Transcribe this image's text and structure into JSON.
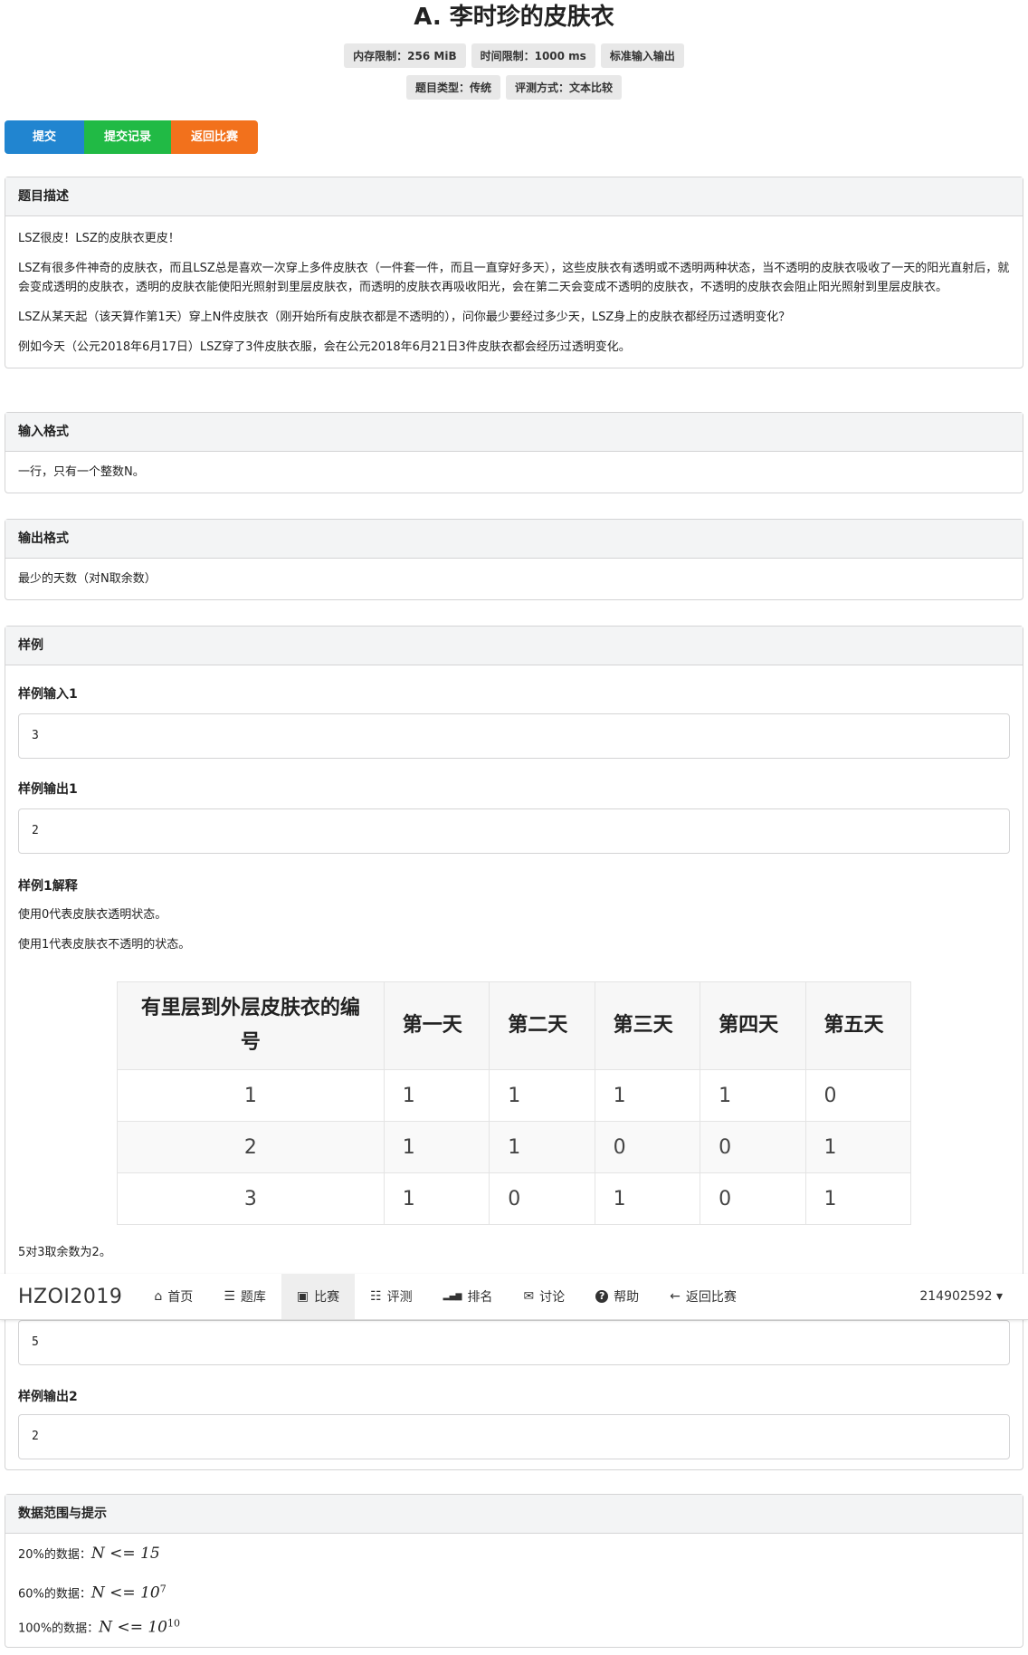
{
  "problem": {
    "title": "A. 李时珍的皮肤衣",
    "labels_row1": [
      "内存限制：256 MiB",
      "时间限制：1000 ms",
      "标准输入输出"
    ],
    "labels_row2": [
      "题目类型：传统",
      "评测方式：文本比较"
    ]
  },
  "actions": {
    "submit": "提交",
    "records": "提交记录",
    "back": "返回比赛"
  },
  "colors": {
    "blue": "#2185d0",
    "green": "#21ba45",
    "orange": "#f2711c"
  },
  "description": {
    "header": "题目描述",
    "p1": "LSZ很皮！LSZ的皮肤衣更皮！",
    "p2": "LSZ有很多件神奇的皮肤衣，而且LSZ总是喜欢一次穿上多件皮肤衣（一件套一件，而且一直穿好多天），这些皮肤衣有透明或不透明两种状态，当不透明的皮肤衣吸收了一天的阳光直射后，就会变成透明的皮肤衣，透明的皮肤衣能使阳光照射到里层皮肤衣，而透明的皮肤衣再吸收阳光，会在第二天会变成不透明的皮肤衣，不透明的皮肤衣会阻止阳光照射到里层皮肤衣。",
    "p3": "LSZ从某天起（该天算作第1天）穿上N件皮肤衣（刚开始所有皮肤衣都是不透明的），问你最少要经过多少天，LSZ身上的皮肤衣都经历过透明变化？",
    "p4": "例如今天（公元2018年6月17日）LSZ穿了3件皮肤衣服，会在公元2018年6月21日3件皮肤衣都会经历过透明变化。"
  },
  "input_format": {
    "header": "输入格式",
    "text": "一行，只有一个整数N。"
  },
  "output_format": {
    "header": "输出格式",
    "text": "最少的天数（对N取余数）"
  },
  "samples": {
    "header": "样例",
    "in1_label": "样例输入1",
    "in1": "3",
    "out1_label": "样例输出1",
    "out1": "2",
    "exp_label": "样例1解释",
    "exp1": "使用0代表皮肤衣透明状态。",
    "exp2": "使用1代表皮肤衣不透明的状态。",
    "table": {
      "headers": [
        "有里层到外层皮肤衣的编号",
        "第一天",
        "第二天",
        "第三天",
        "第四天",
        "第五天"
      ],
      "rows": [
        [
          "1",
          "1",
          "1",
          "1",
          "1",
          "0"
        ],
        [
          "2",
          "1",
          "1",
          "0",
          "0",
          "1"
        ],
        [
          "3",
          "1",
          "0",
          "1",
          "0",
          "1"
        ]
      ]
    },
    "exp3": "5对3取余数为2。",
    "in2": "5",
    "out2_label": "样例输出2",
    "out2": "2"
  },
  "hints": {
    "header": "数据范围与提示",
    "l1_prefix": "20%的数据：",
    "l1_math": "N <= 15",
    "l2_prefix": "60%的数据：",
    "l2_math": "N <= 10",
    "l2_exp": "7",
    "l3_prefix": "100%的数据：",
    "l3_math": "N <= 10",
    "l3_exp": "10"
  },
  "navbar": {
    "brand": "HZOI2019",
    "items": [
      {
        "icon": "home-icon",
        "glyph": "⌂",
        "label": "首页"
      },
      {
        "icon": "list-icon",
        "glyph": "☰",
        "label": "题库"
      },
      {
        "icon": "calendar-icon",
        "glyph": "▣",
        "label": "比赛"
      },
      {
        "icon": "tasks-icon",
        "glyph": "☷",
        "label": "评测"
      },
      {
        "icon": "signal-icon",
        "glyph": "▂▄▆",
        "label": "排名"
      },
      {
        "icon": "comments-icon",
        "glyph": "✉",
        "label": "讨论"
      },
      {
        "icon": "help-icon",
        "glyph": "?",
        "label": "帮助"
      },
      {
        "icon": "arrow-left-icon",
        "glyph": "←",
        "label": "返回比赛"
      }
    ],
    "user": "214902592 ▾"
  }
}
